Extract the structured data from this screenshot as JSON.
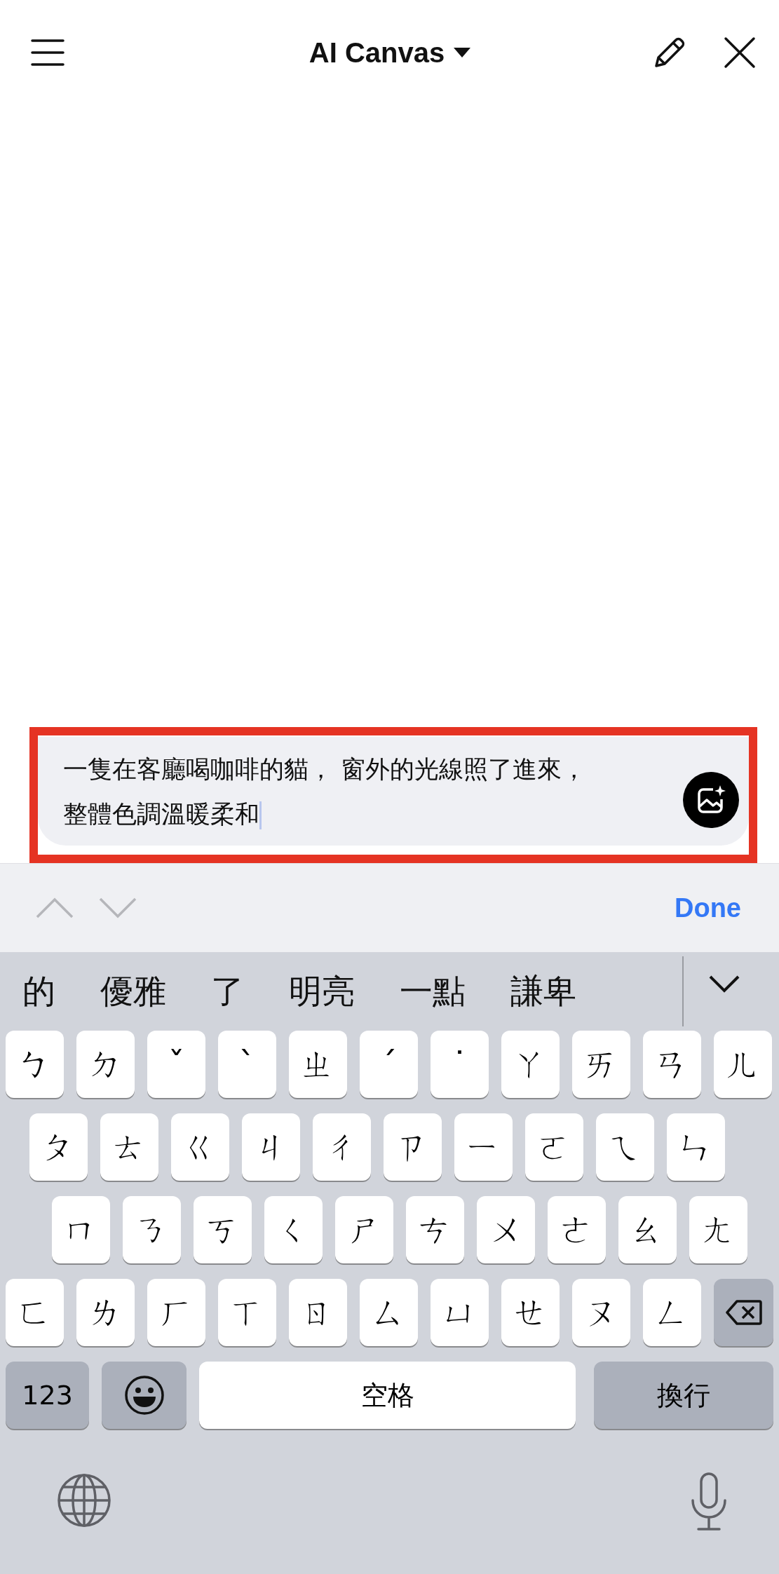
{
  "header": {
    "title": "AI Canvas"
  },
  "prompt": {
    "lines": [
      "一隻在客廳喝咖啡的貓， 窗外的光線照了進來，",
      "整體色調溫暖柔和"
    ],
    "highlighted": true
  },
  "toolbar": {
    "done": "Done"
  },
  "candidates": [
    "的",
    "優雅",
    "了",
    "明亮",
    "一點",
    "謙卑"
  ],
  "keyboard": {
    "rows": [
      [
        "ㄅ",
        "ㄉ",
        "ˇ",
        "ˋ",
        "ㄓ",
        "ˊ",
        "˙",
        "ㄚ",
        "ㄞ",
        "ㄢ",
        "ㄦ"
      ],
      [
        "ㄆ",
        "ㄊ",
        "ㄍ",
        "ㄐ",
        "ㄔ",
        "ㄗ",
        "ㄧ",
        "ㄛ",
        "ㄟ",
        "ㄣ"
      ],
      [
        "ㄇ",
        "ㄋ",
        "ㄎ",
        "ㄑ",
        "ㄕ",
        "ㄘ",
        "ㄨ",
        "ㄜ",
        "ㄠ",
        "ㄤ"
      ],
      [
        "ㄈ",
        "ㄌ",
        "ㄏ",
        "ㄒ",
        "ㄖ",
        "ㄙ",
        "ㄩ",
        "ㄝ",
        "ㄡ",
        "ㄥ"
      ]
    ],
    "numbers": "123",
    "space": "空格",
    "return": "換行"
  }
}
